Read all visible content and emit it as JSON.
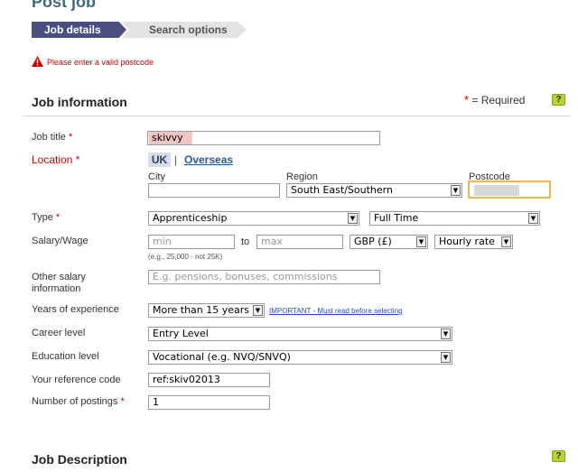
{
  "header": {
    "title": "Post job"
  },
  "steps": {
    "active": "Job details",
    "next": "Search options"
  },
  "error": {
    "message": "Please enter a valid postcode"
  },
  "section_info": {
    "title": "Job information",
    "required_note": "= Required",
    "required_star": "*",
    "help": "?"
  },
  "section_desc": {
    "title": "Job Description",
    "help": "?"
  },
  "fields": {
    "job_title": {
      "label": "Job title",
      "value": "skivvy"
    },
    "location": {
      "label": "Location",
      "uk": "UK",
      "sep": "|",
      "overseas": "Overseas",
      "city_label": "City",
      "city_value": "",
      "region_label": "Region",
      "region_value": "South East/Southern",
      "postcode_label": "Postcode",
      "postcode_value": ""
    },
    "type": {
      "label": "Type",
      "value1": "Apprenticeship",
      "value2": "Full Time"
    },
    "salary": {
      "label": "Salary/Wage",
      "min_placeholder": "min",
      "to": "to",
      "max_placeholder": "max",
      "currency": "GBP (£)",
      "rate": "Hourly rate",
      "hint": "(e.g., 25,000 - not 25K)"
    },
    "other_salary": {
      "label_line1": "Other salary",
      "label_line2": "information",
      "placeholder": "E.g. pensions, bonuses, commissions"
    },
    "experience": {
      "label": "Years of experience",
      "value": "More than 15 years",
      "important": "IMPORTANT - Must read before selecting"
    },
    "career": {
      "label": "Career level",
      "value": "Entry Level"
    },
    "education": {
      "label": "Education level",
      "value": "Vocational (e.g. NVQ/SNVQ)"
    },
    "reference": {
      "label": "Your reference code",
      "value": "ref:skiv02013"
    },
    "postings": {
      "label": "Number of postings",
      "value": "1"
    }
  },
  "colors": {
    "accent": "#3d6a7e",
    "step_active": "#4a4f80",
    "error": "#cc0000",
    "help": "#b7d531",
    "link": "#1e5ab4"
  }
}
